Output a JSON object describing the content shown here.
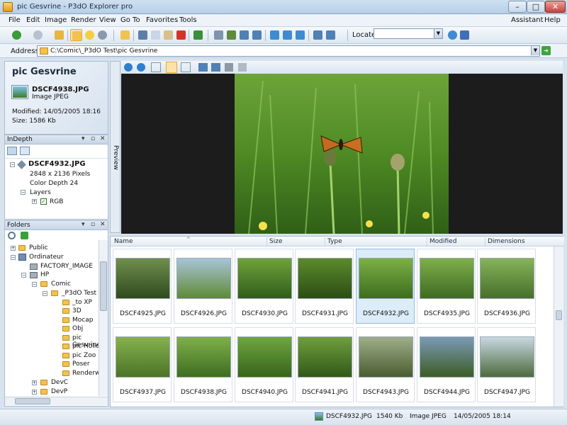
{
  "window": {
    "title": "pic Gesvrine - P3dO Explorer pro"
  },
  "menu": [
    "File",
    "Edit",
    "Image",
    "Render",
    "View",
    "Go To",
    "Favorites",
    "Tools"
  ],
  "menu_right": [
    "Assistant",
    "Help"
  ],
  "toolbar": {
    "locate_label": "Locate"
  },
  "address": {
    "label": "Address",
    "value": "C:\\Comic\\_P3dO Test\\pic Gesvrine"
  },
  "info": {
    "title": "pic Gesvrine",
    "file": "DSCF4938.JPG",
    "type": "Image JPEG",
    "modified": "Modified: 14/05/2005 18:16",
    "size": "Size: 1586 Kb"
  },
  "indepth": {
    "title": "InDepth",
    "file": "DSCF4932.JPG",
    "pixels": "2848 x 2136 Pixels",
    "depth": "Color Depth 24",
    "layers": "Layers",
    "rgb": "RGB"
  },
  "folders": {
    "title": "Folders",
    "items": [
      "Public",
      "Ordinateur",
      "FACTORY_IMAGE",
      "HP",
      "Comic",
      "_P3dO Test",
      "_to XP",
      "3D",
      "Mocap",
      "Obj",
      "pic Gesvrine",
      "pic Holiday",
      "pic Zoo",
      "Poser",
      "Renderware",
      "DevC",
      "DevP"
    ]
  },
  "preview": {
    "tab_label": "Preview"
  },
  "list": {
    "columns": [
      "Name",
      "Size",
      "Type",
      "Modified",
      "Dimensions"
    ],
    "thumbs": [
      {
        "name": "DSCF4925.JPG",
        "c1": "#6f8f4d",
        "c2": "#2f4a1e"
      },
      {
        "name": "DSCF4926.JPG",
        "c1": "#a8c4d8",
        "c2": "#5f8a35"
      },
      {
        "name": "DSCF4930.JPG",
        "c1": "#6fa23a",
        "c2": "#2f5d1a"
      },
      {
        "name": "DSCF4931.JPG",
        "c1": "#5b8b2c",
        "c2": "#2b4d14"
      },
      {
        "name": "DSCF4932.JPG",
        "c1": "#7bb045",
        "c2": "#3d6d1f"
      },
      {
        "name": "DSCF4935.JPG",
        "c1": "#7fae4b",
        "c2": "#3f6b22"
      },
      {
        "name": "DSCF4936.JPG",
        "c1": "#86b35a",
        "c2": "#476f2a"
      },
      {
        "name": "DSCF4937.JPG",
        "c1": "#86b24f",
        "c2": "#4b7327"
      },
      {
        "name": "DSCF4938.JPG",
        "c1": "#7fb04a",
        "c2": "#3e6d21"
      },
      {
        "name": "DSCF4940.JPG",
        "c1": "#6fa640",
        "c2": "#37641a"
      },
      {
        "name": "DSCF4941.JPG",
        "c1": "#6f9f3d",
        "c2": "#315818"
      },
      {
        "name": "DSCF4943.JPG",
        "c1": "#9fae8a",
        "c2": "#4a5d2f"
      },
      {
        "name": "DSCF4944.JPG",
        "c1": "#7b9ab5",
        "c2": "#3b5d25"
      },
      {
        "name": "DSCF4947.JPG",
        "c1": "#c9d8e2",
        "c2": "#4c6b3d"
      }
    ]
  },
  "status": {
    "file": "DSCF4932.JPG",
    "size": "1540 Kb",
    "type": "Image JPEG",
    "modified": "14/05/2005 18:14"
  }
}
